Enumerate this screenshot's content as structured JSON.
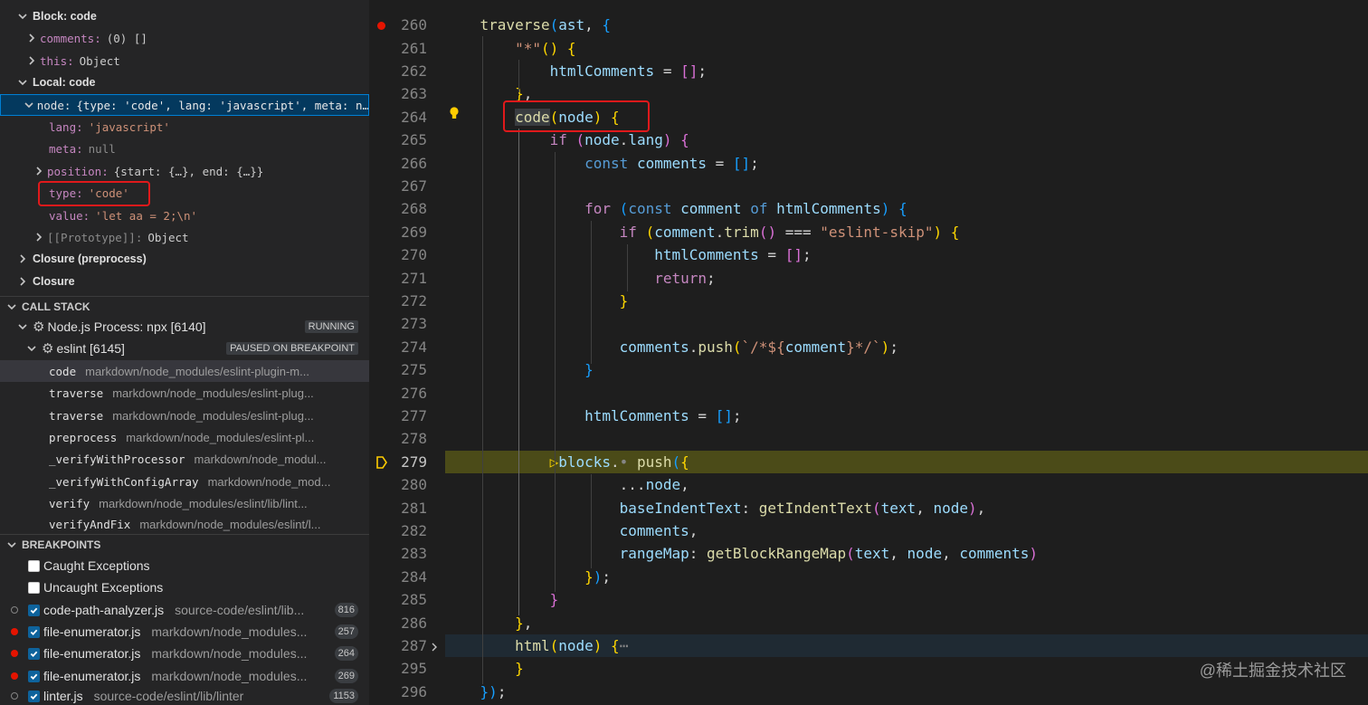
{
  "variables": {
    "block_scope": "Block: code",
    "block_items": [
      {
        "name": "comments",
        "value": "(0) []"
      },
      {
        "name": "this",
        "value": "Object"
      }
    ],
    "local_scope": "Local: code",
    "node_row": {
      "name": "node",
      "value": "{type: 'code', lang: 'javascript', meta: n…"
    },
    "node_children": [
      {
        "name": "lang",
        "value": "'javascript'"
      },
      {
        "name": "meta",
        "value": "null"
      },
      {
        "name": "position",
        "value": "{start: {…}, end: {…}}"
      },
      {
        "name": "type",
        "value": "'code'"
      },
      {
        "name": "value",
        "value": "'let aa = 2;\\n'"
      },
      {
        "name": "[[Prototype]]",
        "value": "Object"
      }
    ],
    "closures": [
      "Closure (preprocess)",
      "Closure"
    ]
  },
  "call_stack": {
    "header": "CALL STACK",
    "processes": [
      {
        "label": "Node.js Process: npx [6140]",
        "status": "RUNNING"
      },
      {
        "label": "eslint [6145]",
        "status": "PAUSED ON BREAKPOINT"
      }
    ],
    "frames": [
      {
        "name": "code",
        "path": "markdown/node_modules/eslint-plugin-m..."
      },
      {
        "name": "traverse",
        "path": "markdown/node_modules/eslint-plug..."
      },
      {
        "name": "traverse",
        "path": "markdown/node_modules/eslint-plug..."
      },
      {
        "name": "preprocess",
        "path": "markdown/node_modules/eslint-pl..."
      },
      {
        "name": "_verifyWithProcessor",
        "path": "markdown/node_modul..."
      },
      {
        "name": "_verifyWithConfigArray",
        "path": "markdown/node_mod..."
      },
      {
        "name": "verify",
        "path": "markdown/node_modules/eslint/lib/lint..."
      },
      {
        "name": "verifyAndFix",
        "path": "markdown/node_modules/eslint/l..."
      }
    ]
  },
  "breakpoints": {
    "header": "BREAKPOINTS",
    "exceptions": [
      "Caught Exceptions",
      "Uncaught Exceptions"
    ],
    "items": [
      {
        "file": "code-path-analyzer.js",
        "path": "source-code/eslint/lib...",
        "line": "816",
        "dot": "hollow"
      },
      {
        "file": "file-enumerator.js",
        "path": "markdown/node_modules...",
        "line": "257",
        "dot": "red"
      },
      {
        "file": "file-enumerator.js",
        "path": "markdown/node_modules...",
        "line": "264",
        "dot": "red"
      },
      {
        "file": "file-enumerator.js",
        "path": "markdown/node_modules...",
        "line": "269",
        "dot": "red"
      },
      {
        "file": "linter.js",
        "path": "source-code/eslint/lib/linter",
        "line": "1153",
        "dot": "hollow"
      }
    ]
  },
  "editor": {
    "line_numbers": [
      "260",
      "261",
      "262",
      "263",
      "264",
      "265",
      "266",
      "267",
      "268",
      "269",
      "270",
      "271",
      "272",
      "273",
      "274",
      "275",
      "276",
      "277",
      "278",
      "279",
      "280",
      "281",
      "282",
      "283",
      "284",
      "285",
      "286",
      "287",
      "295",
      "296"
    ],
    "lines": [
      [
        {
          "t": "    "
        },
        {
          "t": "traverse",
          "c": "f"
        },
        {
          "t": "(",
          "c": "p3"
        },
        {
          "t": "ast",
          "c": "v"
        },
        {
          "t": ", "
        },
        {
          "t": "{",
          "c": "p3"
        }
      ],
      [
        {
          "t": "        "
        },
        {
          "t": "\"*\"",
          "c": "s"
        },
        {
          "t": "()",
          "c": "p1"
        },
        {
          "t": " "
        },
        {
          "t": "{",
          "c": "p1"
        }
      ],
      [
        {
          "t": "            "
        },
        {
          "t": "htmlComments",
          "c": "v"
        },
        {
          "t": " = "
        },
        {
          "t": "[]",
          "c": "p2"
        },
        {
          "t": ";"
        }
      ],
      [
        {
          "t": "        "
        },
        {
          "t": "}",
          "c": "p1"
        },
        {
          "t": ","
        }
      ],
      [
        {
          "t": "        "
        },
        {
          "t": "code",
          "c": "f"
        },
        {
          "t": "(",
          "c": "p1"
        },
        {
          "t": "node",
          "c": "v"
        },
        {
          "t": ")",
          "c": "p1"
        },
        {
          "t": " "
        },
        {
          "t": "{",
          "c": "p1"
        }
      ],
      [
        {
          "t": "            "
        },
        {
          "t": "if",
          "c": "k"
        },
        {
          "t": " "
        },
        {
          "t": "(",
          "c": "p2"
        },
        {
          "t": "node",
          "c": "v"
        },
        {
          "t": "."
        },
        {
          "t": "lang",
          "c": "v"
        },
        {
          "t": ")",
          "c": "p2"
        },
        {
          "t": " "
        },
        {
          "t": "{",
          "c": "p2"
        }
      ],
      [
        {
          "t": "                "
        },
        {
          "t": "const",
          "c": "kb"
        },
        {
          "t": " "
        },
        {
          "t": "comments",
          "c": "v"
        },
        {
          "t": " = "
        },
        {
          "t": "[]",
          "c": "p3"
        },
        {
          "t": ";"
        }
      ],
      [
        {
          "t": ""
        }
      ],
      [
        {
          "t": "                "
        },
        {
          "t": "for",
          "c": "k"
        },
        {
          "t": " "
        },
        {
          "t": "(",
          "c": "p3"
        },
        {
          "t": "const",
          "c": "kb"
        },
        {
          "t": " "
        },
        {
          "t": "comment",
          "c": "v"
        },
        {
          "t": " "
        },
        {
          "t": "of",
          "c": "kb"
        },
        {
          "t": " "
        },
        {
          "t": "htmlComments",
          "c": "v"
        },
        {
          "t": ")",
          "c": "p3"
        },
        {
          "t": " "
        },
        {
          "t": "{",
          "c": "p3"
        }
      ],
      [
        {
          "t": "                    "
        },
        {
          "t": "if",
          "c": "k"
        },
        {
          "t": " "
        },
        {
          "t": "(",
          "c": "p1"
        },
        {
          "t": "comment",
          "c": "v"
        },
        {
          "t": "."
        },
        {
          "t": "trim",
          "c": "f"
        },
        {
          "t": "()",
          "c": "p2"
        },
        {
          "t": " === "
        },
        {
          "t": "\"eslint-skip\"",
          "c": "s"
        },
        {
          "t": ")",
          "c": "p1"
        },
        {
          "t": " "
        },
        {
          "t": "{",
          "c": "p1"
        }
      ],
      [
        {
          "t": "                        "
        },
        {
          "t": "htmlComments",
          "c": "v"
        },
        {
          "t": " = "
        },
        {
          "t": "[]",
          "c": "p2"
        },
        {
          "t": ";"
        }
      ],
      [
        {
          "t": "                        "
        },
        {
          "t": "return",
          "c": "k"
        },
        {
          "t": ";"
        }
      ],
      [
        {
          "t": "                    "
        },
        {
          "t": "}",
          "c": "p1"
        }
      ],
      [
        {
          "t": ""
        }
      ],
      [
        {
          "t": "                    "
        },
        {
          "t": "comments",
          "c": "v"
        },
        {
          "t": "."
        },
        {
          "t": "push",
          "c": "f"
        },
        {
          "t": "(",
          "c": "p1"
        },
        {
          "t": "`/*${",
          "c": "s"
        },
        {
          "t": "comment",
          "c": "v"
        },
        {
          "t": "}*/`",
          "c": "s"
        },
        {
          "t": ")",
          "c": "p1"
        },
        {
          "t": ";"
        }
      ],
      [
        {
          "t": "                "
        },
        {
          "t": "}",
          "c": "p3"
        }
      ],
      [
        {
          "t": ""
        }
      ],
      [
        {
          "t": "                "
        },
        {
          "t": "htmlComments",
          "c": "v"
        },
        {
          "t": " = "
        },
        {
          "t": "[]",
          "c": "p3"
        },
        {
          "t": ";"
        }
      ],
      [
        {
          "t": ""
        }
      ],
      [
        {
          "t": "            "
        },
        {
          "t": "▷",
          "c": "p1"
        },
        {
          "t": "blocks",
          "c": "v"
        },
        {
          "t": "."
        },
        {
          "t": "•",
          "c": "g"
        },
        {
          "t": " "
        },
        {
          "t": "push",
          "c": "f"
        },
        {
          "t": "(",
          "c": "p3"
        },
        {
          "t": "{",
          "c": "p1"
        }
      ],
      [
        {
          "t": "                    "
        },
        {
          "t": "..."
        },
        {
          "t": "node",
          "c": "v"
        },
        {
          "t": ","
        }
      ],
      [
        {
          "t": "                    "
        },
        {
          "t": "baseIndentText",
          "c": "v"
        },
        {
          "t": ": "
        },
        {
          "t": "getIndentText",
          "c": "f"
        },
        {
          "t": "(",
          "c": "p2"
        },
        {
          "t": "text",
          "c": "v"
        },
        {
          "t": ", "
        },
        {
          "t": "node",
          "c": "v"
        },
        {
          "t": ")",
          "c": "p2"
        },
        {
          "t": ","
        }
      ],
      [
        {
          "t": "                    "
        },
        {
          "t": "comments",
          "c": "v"
        },
        {
          "t": ","
        }
      ],
      [
        {
          "t": "                    "
        },
        {
          "t": "rangeMap",
          "c": "v"
        },
        {
          "t": ": "
        },
        {
          "t": "getBlockRangeMap",
          "c": "f"
        },
        {
          "t": "(",
          "c": "p2"
        },
        {
          "t": "text",
          "c": "v"
        },
        {
          "t": ", "
        },
        {
          "t": "node",
          "c": "v"
        },
        {
          "t": ", "
        },
        {
          "t": "comments",
          "c": "v"
        },
        {
          "t": ")",
          "c": "p2"
        }
      ],
      [
        {
          "t": "                "
        },
        {
          "t": "}",
          "c": "p1"
        },
        {
          "t": ")",
          "c": "p3"
        },
        {
          "t": ";"
        }
      ],
      [
        {
          "t": "            "
        },
        {
          "t": "}",
          "c": "p2"
        }
      ],
      [
        {
          "t": "        "
        },
        {
          "t": "}",
          "c": "p1"
        },
        {
          "t": ","
        }
      ],
      [
        {
          "t": "        "
        },
        {
          "t": "html",
          "c": "f"
        },
        {
          "t": "(",
          "c": "p1"
        },
        {
          "t": "node",
          "c": "v"
        },
        {
          "t": ")",
          "c": "p1"
        },
        {
          "t": " "
        },
        {
          "t": "{",
          "c": "p1"
        },
        {
          "t": "⋯",
          "c": "g"
        }
      ],
      [
        {
          "t": "        "
        },
        {
          "t": "}",
          "c": "p1"
        }
      ],
      [
        {
          "t": "    "
        },
        {
          "t": "}",
          "c": "p3"
        },
        {
          "t": ")",
          "c": "p3"
        },
        {
          "t": ";"
        }
      ]
    ]
  },
  "watermark": "@稀土掘金技术社区",
  "colors": {
    "accent": "#007fd4",
    "breakpoint": "#e51400",
    "callout": "#e0191b",
    "current_line": "#4b4b18"
  }
}
